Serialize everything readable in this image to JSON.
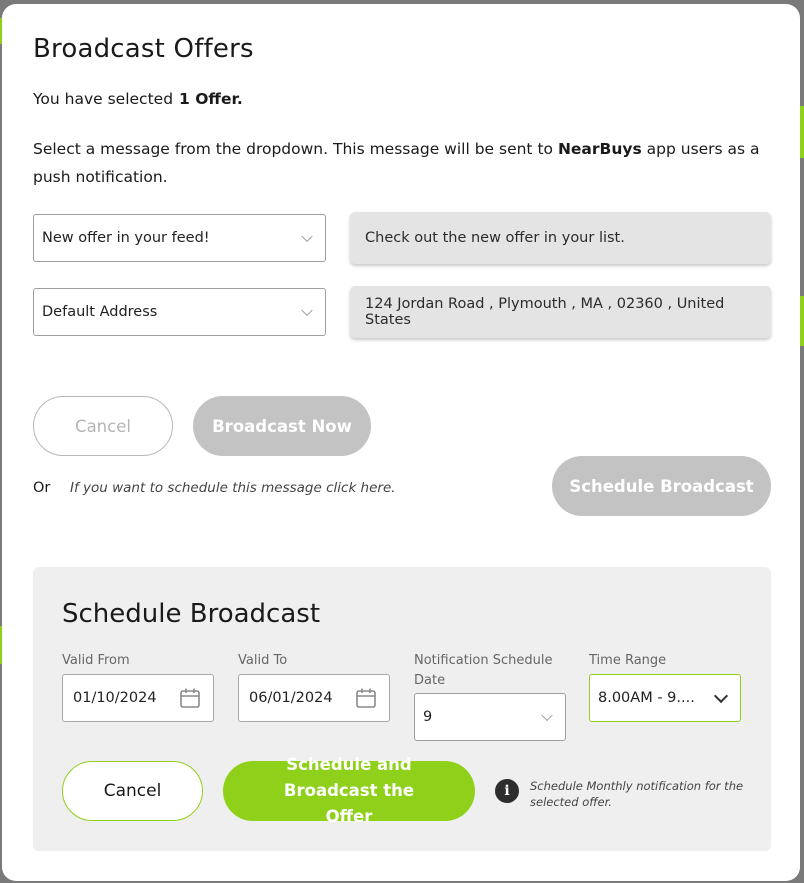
{
  "modal": {
    "title": "Broadcast Offers",
    "selected_prefix": "You have selected",
    "selected_count": "1 Offer.",
    "instruction_before": "Select a message from the dropdown. This message will be sent to ",
    "app_name": "NearBuys",
    "instruction_after": " app users as a push notification.",
    "message_select": {
      "value": "New offer in your feed!"
    },
    "message_preview": "Check out the new offer in your list.",
    "address_select": {
      "value": "Default Address"
    },
    "address_preview": "124 Jordan Road , Plymouth , MA , 02360 , United States",
    "cancel_label": "Cancel",
    "broadcast_now_label": "Broadcast Now",
    "or_label": "Or",
    "schedule_hint": "If you want to schedule this message click here.",
    "schedule_broadcast_label": "Schedule Broadcast"
  },
  "schedule": {
    "title": "Schedule Broadcast",
    "valid_from_label": "Valid From",
    "valid_from_value": "01/10/2024",
    "valid_to_label": "Valid To",
    "valid_to_value": "06/01/2024",
    "notification_date_label": "Notification Schedule Date",
    "notification_date_value": "9",
    "time_range_label": "Time Range",
    "time_range_value": "8.00AM - 9....",
    "cancel_label": "Cancel",
    "submit_label": "Schedule and Broadcast the Offer",
    "info_note": "Schedule Monthly notification for the selected offer."
  },
  "colors": {
    "accent_green": "#8fd11a",
    "disabled_gray": "#c3c3c3",
    "panel_bg": "#efefef"
  },
  "icons": [
    "chevron-down-icon",
    "calendar-icon",
    "info-icon"
  ]
}
